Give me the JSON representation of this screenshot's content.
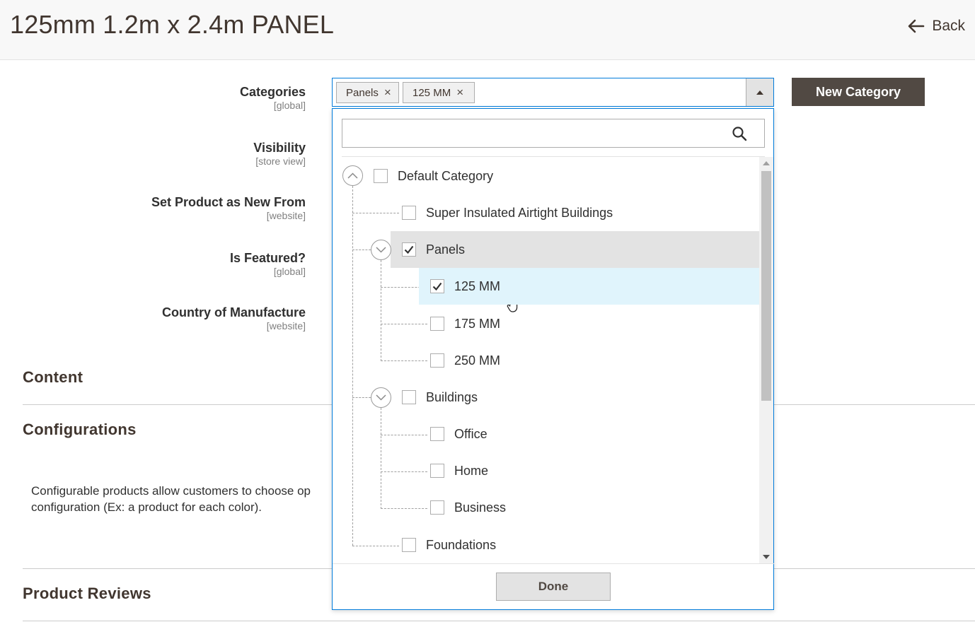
{
  "header": {
    "title": "125mm 1.2m x 2.4m PANEL",
    "back_label": "Back"
  },
  "fields": [
    {
      "name": "Categories",
      "scope": "[global]"
    },
    {
      "name": "Visibility",
      "scope": "[store view]"
    },
    {
      "name": "Set Product as New From",
      "scope": "[website]"
    },
    {
      "name": "Is Featured?",
      "scope": "[global]"
    },
    {
      "name": "Country of Manufacture",
      "scope": "[website]"
    }
  ],
  "categories": {
    "selected_chips": [
      "Panels",
      "125 MM"
    ],
    "chip_remove_glyph": "×",
    "new_category_label": "New Category",
    "search_placeholder": "",
    "done_label": "Done",
    "tree": [
      {
        "label": "Default Category",
        "checked": false,
        "expanded": true
      },
      {
        "label": "Super Insulated Airtight Buildings",
        "checked": false
      },
      {
        "label": "Panels",
        "checked": true,
        "expanded": true,
        "highlight": "hover"
      },
      {
        "label": "125 MM",
        "checked": true,
        "highlight": "selected"
      },
      {
        "label": "175 MM",
        "checked": false
      },
      {
        "label": "250 MM",
        "checked": false
      },
      {
        "label": "Buildings",
        "checked": false,
        "expanded": true
      },
      {
        "label": "Office",
        "checked": false
      },
      {
        "label": "Home",
        "checked": false
      },
      {
        "label": "Business",
        "checked": false
      },
      {
        "label": "Foundations",
        "checked": false
      }
    ]
  },
  "sections": {
    "content": "Content",
    "configurations": "Configurations",
    "configurations_text_line1": "Configurable products allow customers to choose op",
    "configurations_text_line2": "configuration (Ex: a product for each color).",
    "product_reviews": "Product Reviews"
  },
  "colors": {
    "accent_border": "#007bdb",
    "button_dark": "#514943",
    "row_hover": "#e3e3e3",
    "row_selected": "#e0f4fc"
  }
}
